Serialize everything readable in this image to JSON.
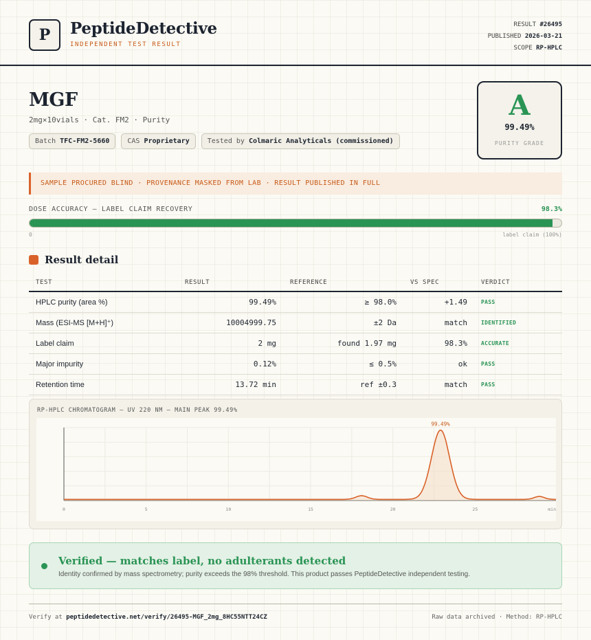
{
  "header": {
    "logo_letter": "P",
    "brand": "PeptideDetective",
    "tagline": "INDEPENDENT TEST RESULT",
    "result_label": "RESULT",
    "result_id": "#26495",
    "published_label": "PUBLISHED",
    "published_date": "2026-03-21",
    "scope_label": "SCOPE",
    "scope_value": "RP-HPLC"
  },
  "product": {
    "name": "MGF",
    "subtitle": "2mg×10vials · Cat. FM2 · Purity",
    "chips": [
      {
        "label": "Batch",
        "value": "TFC-FM2-5660"
      },
      {
        "label": "CAS",
        "value": "Proprietary"
      },
      {
        "label": "Tested by",
        "value": "Colmaric Analyticals (commissioned)"
      }
    ]
  },
  "grade": {
    "letter": "A",
    "value": "99.49%",
    "label": "PURITY GRADE"
  },
  "notice": "SAMPLE PROCURED BLIND · PROVENANCE MASKED FROM LAB · RESULT PUBLISHED IN FULL",
  "dose": {
    "label": "DOSE ACCURACY — LABEL CLAIM RECOVERY",
    "value": "98.3%",
    "fraction": 0.983,
    "min_label": "0",
    "max_label": "label claim (100%)"
  },
  "section_title": "Result detail",
  "table": {
    "headers": [
      "TEST",
      "RESULT",
      "REFERENCE",
      "VS SPEC",
      "VERDICT"
    ],
    "rows": [
      {
        "test": "HPLC purity (area %)",
        "result": "99.49%",
        "reference": "≥ 98.0%",
        "vs_spec": "+1.49",
        "verdict": "PASS"
      },
      {
        "test": "Mass (ESI-MS [M+H]⁺)",
        "result": "10004999.75",
        "reference": "±2 Da",
        "vs_spec": "match",
        "verdict": "IDENTIFIED"
      },
      {
        "test": "Label claim",
        "result": "2 mg",
        "reference": "found 1.97 mg",
        "vs_spec": "98.3%",
        "verdict": "ACCURATE"
      },
      {
        "test": "Major impurity",
        "result": "0.12%",
        "reference": "≤ 0.5%",
        "vs_spec": "ok",
        "verdict": "PASS"
      },
      {
        "test": "Retention time",
        "result": "13.72 min",
        "reference": "ref ±0.3",
        "vs_spec": "match",
        "verdict": "PASS"
      }
    ]
  },
  "chart_title": "RP-HPLC CHROMATOGRAM — UV 220 NM — MAIN PEAK 99.49%",
  "chart_data": {
    "type": "line",
    "xlim": [
      0,
      30
    ],
    "x_ticks": [
      "0",
      "5",
      "10",
      "15",
      "20",
      "25"
    ],
    "x_unit": "min",
    "ylim": [
      0,
      100
    ],
    "peaks": [
      {
        "x": 18.1,
        "height": 5,
        "width": 0.35
      },
      {
        "x": 22.9,
        "height": 95,
        "width": 0.55,
        "label": "99.49%"
      },
      {
        "x": 28.9,
        "height": 4,
        "width": 0.3
      }
    ],
    "baseline": 1.5,
    "color": "#d9622a"
  },
  "verified": {
    "title": "Verified — matches label, no adulterants detected",
    "text": "Identity confirmed by mass spectrometry; purity exceeds the 98% threshold. This product passes PeptideDetective independent testing."
  },
  "footer": {
    "verify_label": "Verify at",
    "verify_url": "peptidedetective.net/verify/26495-MGF_2mg_8HC55NTT24CZ",
    "right": "Raw data archived · Method: RP-HPLC"
  },
  "colors": {
    "accent": "#d9622a",
    "pass": "#2a9455",
    "ink": "#1d2430"
  }
}
